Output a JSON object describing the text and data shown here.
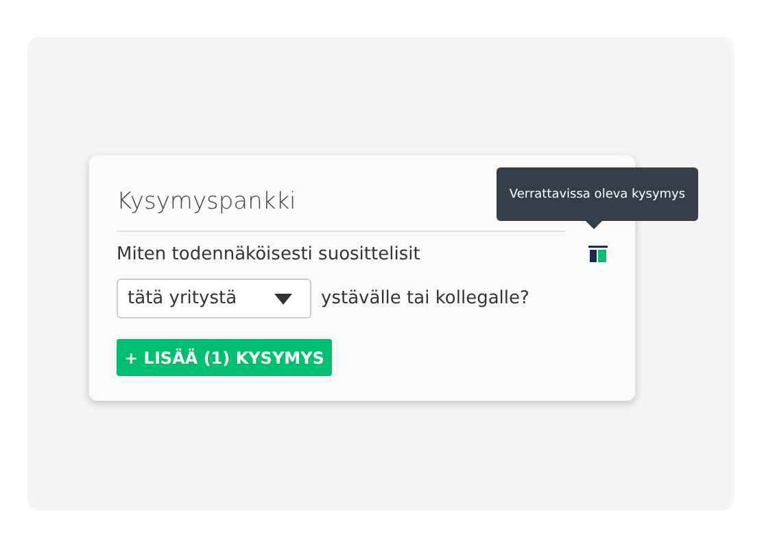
{
  "panel": {
    "title": "Kysymyspankki",
    "question": {
      "text_before": "Miten todennäköisesti suosittelisit",
      "dropdown": {
        "value": "tätä yritystä"
      },
      "text_after": "ystävälle tai kollegalle?"
    },
    "tooltip": "Verrattavissa oleva kysymys",
    "add_button": "+ LISÄÄ (1) KYSYMYS"
  }
}
